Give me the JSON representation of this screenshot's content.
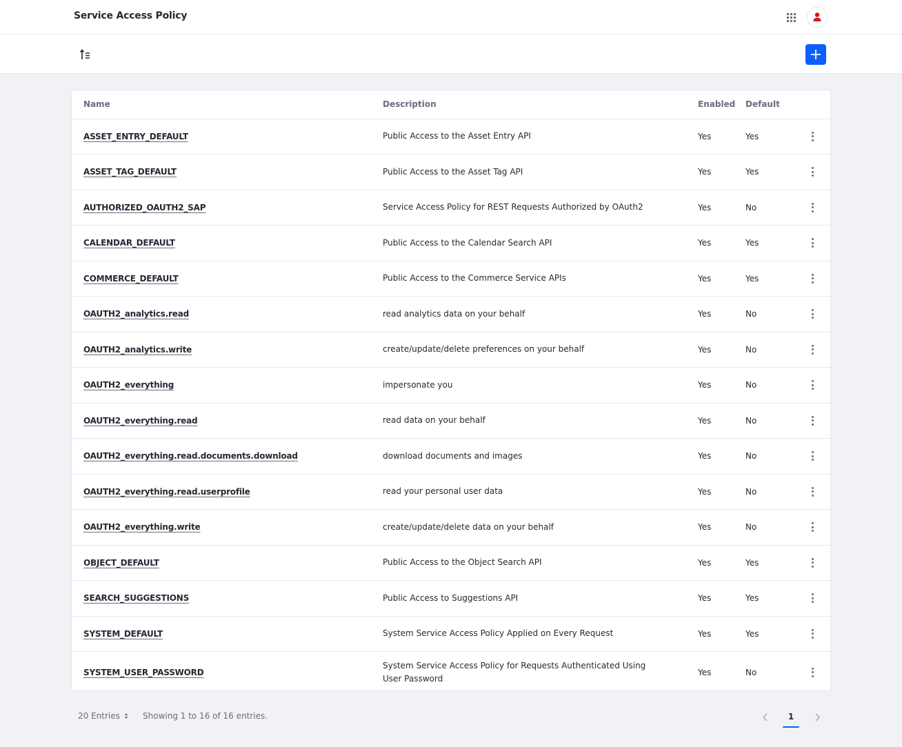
{
  "header": {
    "title": "Service Access Policy"
  },
  "colors": {
    "accent": "#0b5fff",
    "avatar_icon": "#da1414"
  },
  "table": {
    "columns": {
      "name": "Name",
      "description": "Description",
      "enabled": "Enabled",
      "default": "Default"
    },
    "rows": [
      {
        "name": "ASSET_ENTRY_DEFAULT",
        "description": "Public Access to the Asset Entry API",
        "enabled": "Yes",
        "default": "Yes"
      },
      {
        "name": "ASSET_TAG_DEFAULT",
        "description": "Public Access to the Asset Tag API",
        "enabled": "Yes",
        "default": "Yes"
      },
      {
        "name": "AUTHORIZED_OAUTH2_SAP",
        "description": "Service Access Policy for REST Requests Authorized by OAuth2",
        "enabled": "Yes",
        "default": "No"
      },
      {
        "name": "CALENDAR_DEFAULT",
        "description": "Public Access to the Calendar Search API",
        "enabled": "Yes",
        "default": "Yes"
      },
      {
        "name": "COMMERCE_DEFAULT",
        "description": "Public Access to the Commerce Service APIs",
        "enabled": "Yes",
        "default": "Yes"
      },
      {
        "name": "OAUTH2_analytics.read",
        "description": "read analytics data on your behalf",
        "enabled": "Yes",
        "default": "No"
      },
      {
        "name": "OAUTH2_analytics.write",
        "description": "create/update/delete preferences on your behalf",
        "enabled": "Yes",
        "default": "No"
      },
      {
        "name": "OAUTH2_everything",
        "description": "impersonate you",
        "enabled": "Yes",
        "default": "No"
      },
      {
        "name": "OAUTH2_everything.read",
        "description": "read data on your behalf",
        "enabled": "Yes",
        "default": "No"
      },
      {
        "name": "OAUTH2_everything.read.documents.download",
        "description": "download documents and images",
        "enabled": "Yes",
        "default": "No"
      },
      {
        "name": "OAUTH2_everything.read.userprofile",
        "description": "read your personal user data",
        "enabled": "Yes",
        "default": "No"
      },
      {
        "name": "OAUTH2_everything.write",
        "description": "create/update/delete data on your behalf",
        "enabled": "Yes",
        "default": "No"
      },
      {
        "name": "OBJECT_DEFAULT",
        "description": "Public Access to the Object Search API",
        "enabled": "Yes",
        "default": "Yes"
      },
      {
        "name": "SEARCH_SUGGESTIONS",
        "description": "Public Access to Suggestions API",
        "enabled": "Yes",
        "default": "Yes"
      },
      {
        "name": "SYSTEM_DEFAULT",
        "description": "System Service Access Policy Applied on Every Request",
        "enabled": "Yes",
        "default": "Yes"
      },
      {
        "name": "SYSTEM_USER_PASSWORD",
        "description": "System Service Access Policy for Requests Authenticated Using User Password",
        "enabled": "Yes",
        "default": "No"
      }
    ]
  },
  "pagination": {
    "entries_label": "20 Entries",
    "showing_text": "Showing 1 to 16 of 16 entries.",
    "current_page": "1"
  }
}
